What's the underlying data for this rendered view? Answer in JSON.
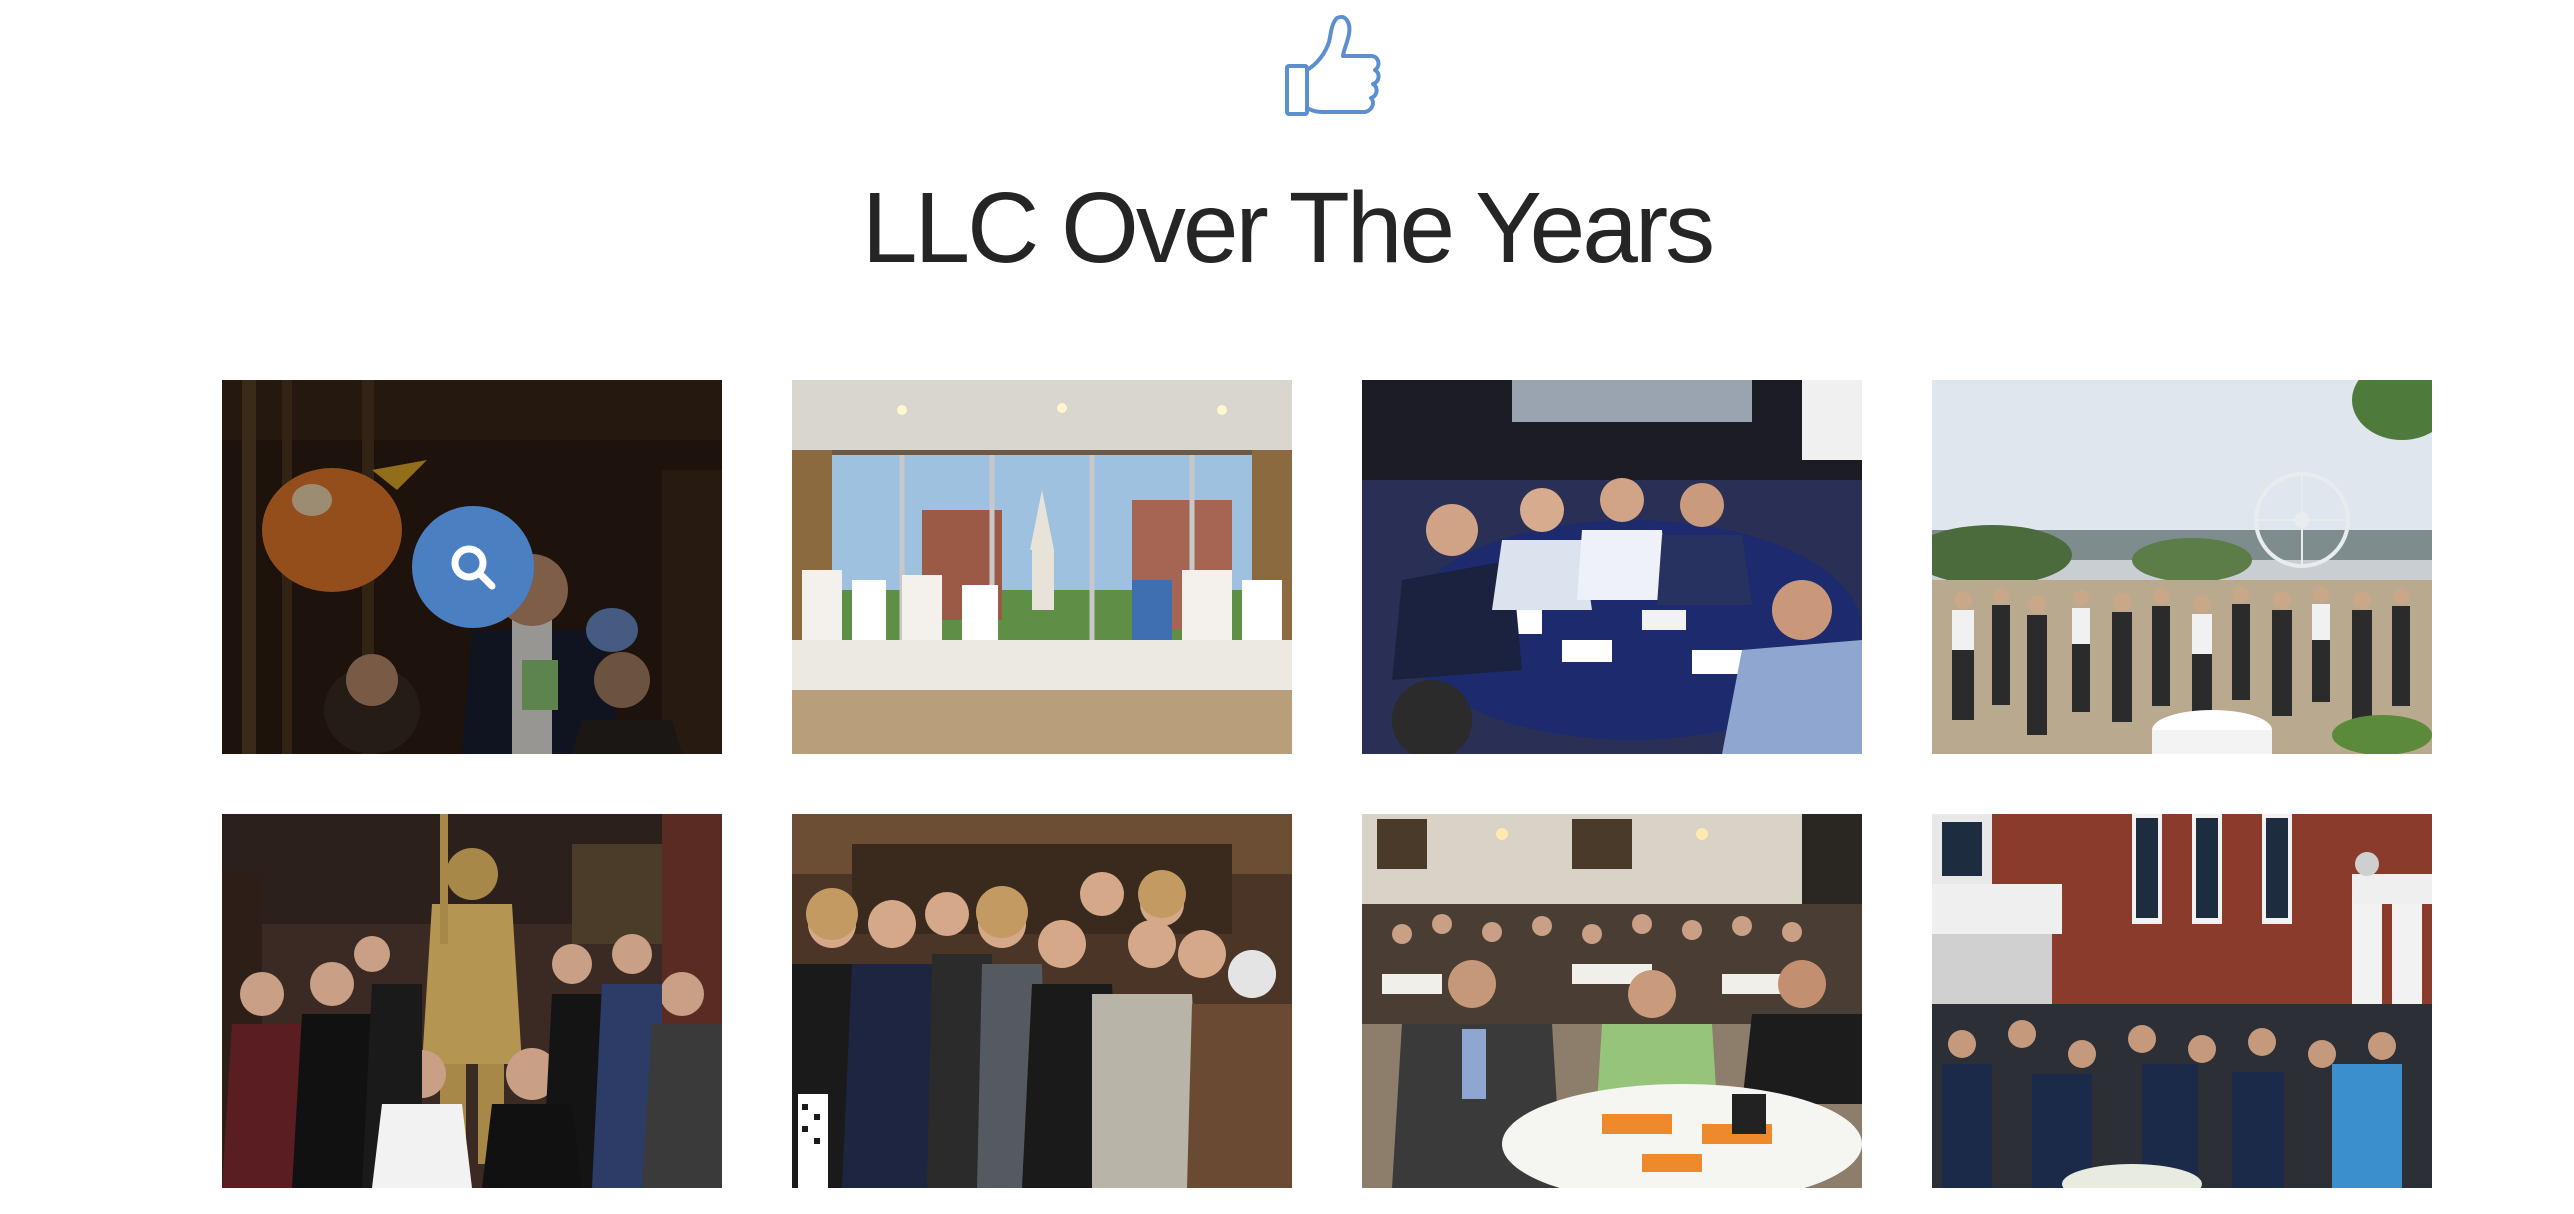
{
  "section": {
    "icon": "thumbs-up-icon",
    "title": "LLC Over The Years"
  },
  "gallery": {
    "zoom_icon": "search-icon",
    "hovered_index": 0,
    "photos": [
      {
        "scene": "event-mascot-photo"
      },
      {
        "scene": "exhibit-hall-window-photo"
      },
      {
        "scene": "roundtable-discussion-photo"
      },
      {
        "scene": "waterfront-reception-photo"
      },
      {
        "scene": "group-with-statue-photo"
      },
      {
        "scene": "group-portrait-photo"
      },
      {
        "scene": "banquet-hall-photo"
      },
      {
        "scene": "courtyard-reception-photo"
      }
    ]
  },
  "colors": {
    "accent": "#4a7fc1",
    "title": "#252525",
    "background": "#ffffff"
  }
}
